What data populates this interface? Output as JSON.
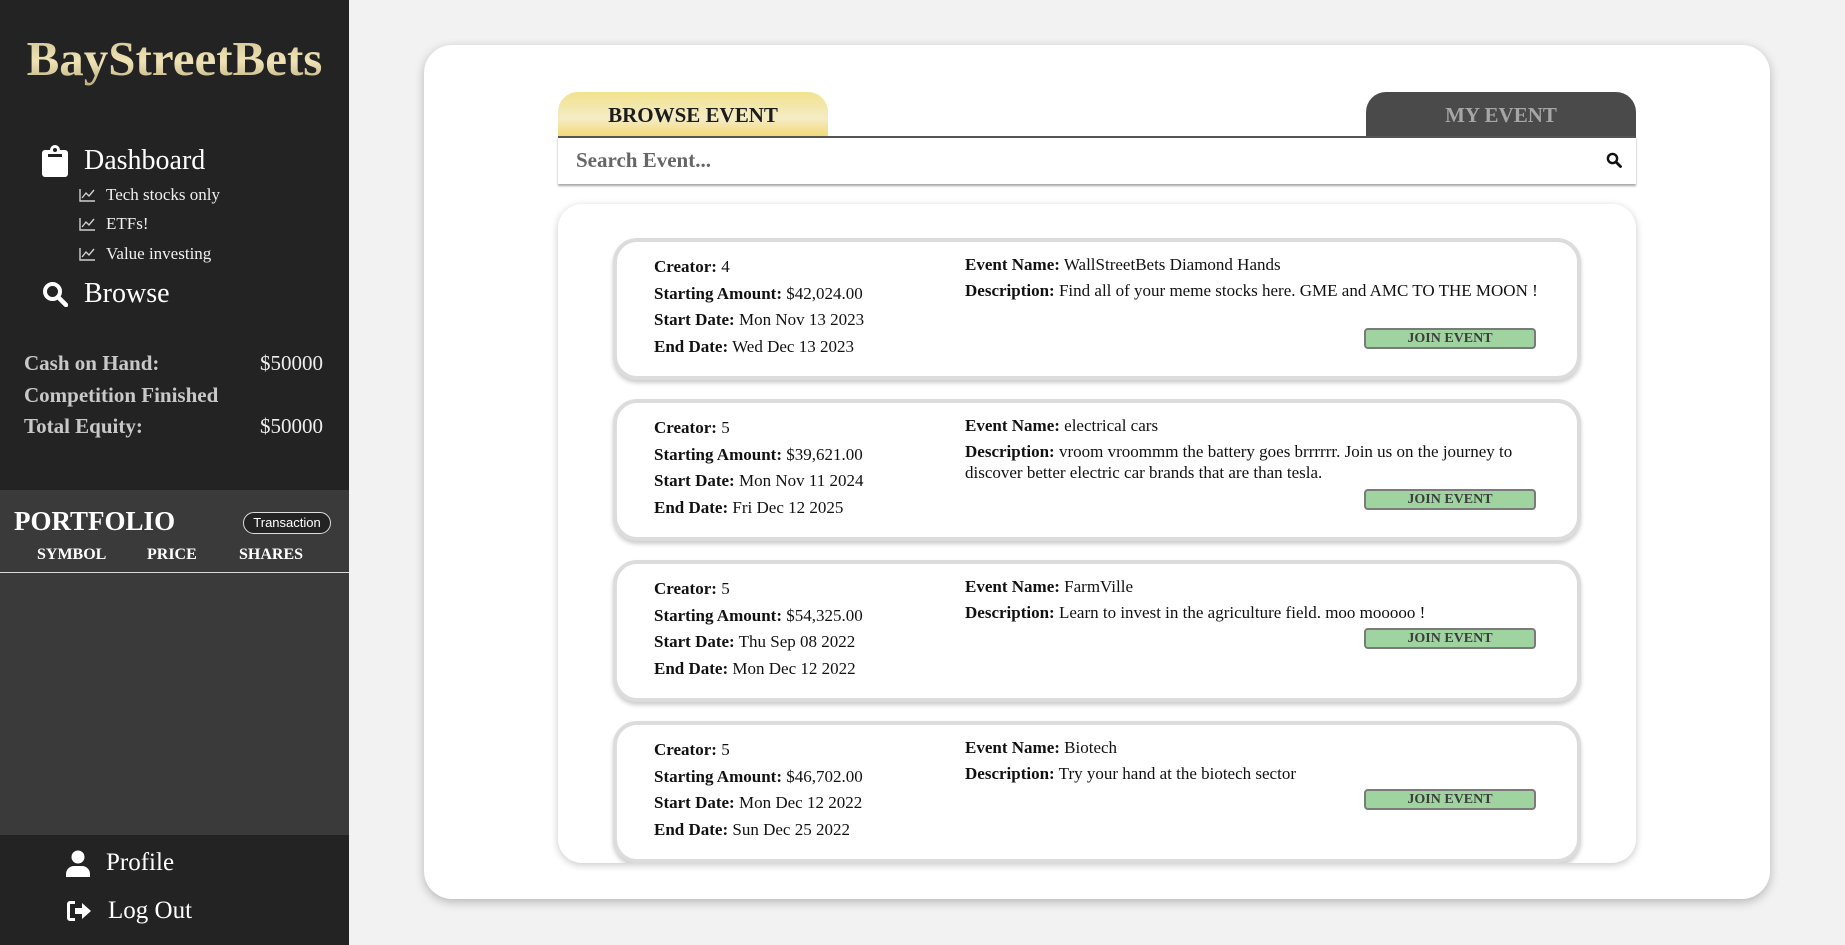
{
  "brand": "BayStreetBets",
  "sidebar": {
    "dashboard": "Dashboard",
    "sub_items": [
      {
        "label": "Tech stocks only"
      },
      {
        "label": "ETFs!"
      },
      {
        "label": "Value investing"
      }
    ],
    "browse": "Browse",
    "cash_label": "Cash on Hand:",
    "cash_value": "$50000",
    "competition_status": "Competition Finished",
    "equity_label": "Total Equity:",
    "equity_value": "$50000",
    "portfolio": {
      "title": "PORTFOLIO",
      "transaction_button": "Transaction",
      "headers": [
        "SYMBOL",
        "PRICE",
        "SHARES"
      ]
    },
    "profile": "Profile",
    "logout": "Log Out"
  },
  "tabs": {
    "browse": "BROWSE EVENT",
    "my": "MY EVENT"
  },
  "search": {
    "placeholder": "Search Event..."
  },
  "labels": {
    "creator": "Creator:",
    "starting_amount": "Starting Amount:",
    "start_date": "Start Date:",
    "end_date": "End Date:",
    "event_name": "Event Name:",
    "description": "Description:",
    "join": "JOIN EVENT"
  },
  "events": [
    {
      "creator": "4",
      "starting_amount": "$42,024.00",
      "start_date": "Mon Nov 13 2023",
      "end_date": "Wed Dec 13 2023",
      "name": "WallStreetBets Diamond Hands",
      "description": "Find all of your meme stocks here. GME and AMC TO THE MOON !"
    },
    {
      "creator": "5",
      "starting_amount": "$39,621.00",
      "start_date": "Mon Nov 11 2024",
      "end_date": "Fri Dec 12 2025",
      "name": "electrical cars",
      "description": "vroom vroommm the battery goes brrrrrr. Join us on the journey to discover better electric car brands that are than tesla."
    },
    {
      "creator": "5",
      "starting_amount": "$54,325.00",
      "start_date": "Thu Sep 08 2022",
      "end_date": "Mon Dec 12 2022",
      "name": "FarmVille",
      "description": "Learn to invest in the agriculture field. moo mooooo !"
    },
    {
      "creator": "5",
      "starting_amount": "$46,702.00",
      "start_date": "Mon Dec 12 2022",
      "end_date": "Sun Dec 25 2022",
      "name": "Biotech",
      "description": "Try your hand at the biotech sector"
    }
  ]
}
